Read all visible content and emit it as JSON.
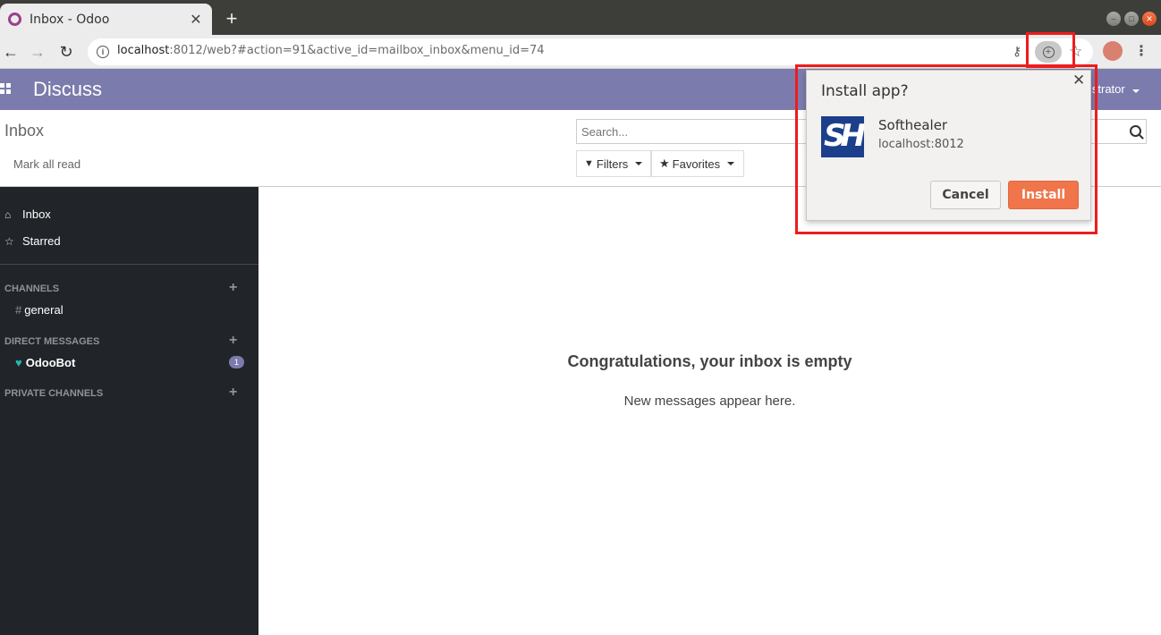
{
  "browser": {
    "tab_title": "Inbox - Odoo",
    "tab_close": "✕",
    "new_tab": "+",
    "url_host": "localhost",
    "url_rest": ":8012/web?#action=91&active_id=mailbox_inbox&menu_id=74",
    "window_controls": [
      "minimize",
      "maximize",
      "close"
    ]
  },
  "navbar": {
    "app_title": "Discuss",
    "user": "istrator"
  },
  "control_panel": {
    "breadcrumb": "Inbox",
    "mark_all_read": "Mark all read",
    "search_placeholder": "Search...",
    "filters_label": "Filters",
    "favorites_label": "Favorites"
  },
  "sidebar": {
    "inbox": "Inbox",
    "starred": "Starred",
    "channels_header": "CHANNELS",
    "channel_general": "general",
    "direct_header": "DIRECT MESSAGES",
    "direct_odoobot": "OdooBot",
    "odoobot_count": "1",
    "private_header": "PRIVATE CHANNELS"
  },
  "main": {
    "empty_title": "Congratulations, your inbox is empty",
    "empty_subtitle": "New messages appear here."
  },
  "install_popup": {
    "title": "Install app?",
    "close": "✕",
    "app_name": "Softhealer",
    "app_origin": "localhost:8012",
    "cancel_label": "Cancel",
    "install_label": "Install",
    "accent_color": "#f0754b"
  },
  "colors": {
    "odoo_brand": "#7c7bad",
    "sidebar_bg": "#212529",
    "highlight": "#ee1c1c"
  }
}
